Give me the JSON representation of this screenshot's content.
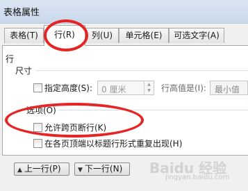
{
  "window": {
    "title": "表格属性"
  },
  "tabs": [
    {
      "label": "表格(T)",
      "active": false
    },
    {
      "label": "行(R)",
      "active": true
    },
    {
      "label": "列(U)",
      "active": false
    },
    {
      "label": "单元格(E)",
      "active": false
    },
    {
      "label": "可选文字(A)",
      "active": false
    }
  ],
  "row_section": {
    "heading": "行",
    "size_heading": "尺寸",
    "specify_height_label": "指定高度(S):",
    "height_value": "0 厘米",
    "row_height_label": "行高值是(I):",
    "row_height_value": "最小值"
  },
  "options": {
    "heading": "选项(O)",
    "allow_break_label": "允许跨页断行(K)",
    "repeat_header_label": "在各页顶端以标题行形式重复出现(H)"
  },
  "buttons": {
    "prev_row": "上一行(P)",
    "next_row": "下一行(N)"
  },
  "watermark": "Baidu 经验",
  "watermark_sub": "jingyan.baidu.com",
  "colors": {
    "highlight_circle": "#e52424",
    "panel_bg": "#ffffff"
  }
}
